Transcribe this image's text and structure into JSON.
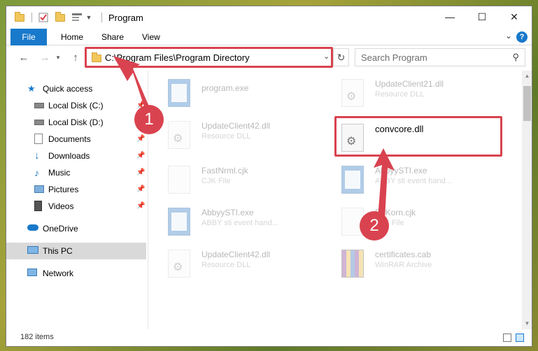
{
  "window": {
    "title": "Program",
    "controls": {
      "minimize": "—",
      "maximize": "☐",
      "close": "✕"
    }
  },
  "ribbon": {
    "tabs": [
      "File",
      "Home",
      "Share",
      "View"
    ],
    "help": "?"
  },
  "address": {
    "path": "C:\\Program Files\\Program Directory",
    "search_placeholder": "Search Program"
  },
  "sidebar": {
    "items": [
      {
        "label": "Quick access",
        "icon": "star-icon"
      },
      {
        "label": "Local Disk (C:)",
        "icon": "drive-icon"
      },
      {
        "label": "Local Disk (D:)",
        "icon": "drive-icon"
      },
      {
        "label": "Documents",
        "icon": "documents-icon"
      },
      {
        "label": "Downloads",
        "icon": "download-icon"
      },
      {
        "label": "Music",
        "icon": "music-icon"
      },
      {
        "label": "Pictures",
        "icon": "pictures-icon"
      },
      {
        "label": "Videos",
        "icon": "videos-icon"
      },
      {
        "label": "OneDrive",
        "icon": "cloud-icon"
      },
      {
        "label": "This PC",
        "icon": "computer-icon"
      },
      {
        "label": "Network",
        "icon": "network-icon"
      }
    ]
  },
  "files": [
    {
      "name": "program.exe",
      "type": ""
    },
    {
      "name": "UpdateClient21.dll",
      "type": "Resource DLL"
    },
    {
      "name": "UpdateClient42.dll",
      "type": "Resource DLL"
    },
    {
      "name": "convcore.dll",
      "type": ""
    },
    {
      "name": "FastNrml.cjk",
      "type": "CJK File"
    },
    {
      "name": "AbbyySTI.exe",
      "type": "ABBY sti event hand..."
    },
    {
      "name": "AbbyySTI.exe",
      "type": "ABBY sti event hand..."
    },
    {
      "name": "EdKorn.cjk",
      "type": "CJK File"
    },
    {
      "name": "UpdateClient42.dll",
      "type": "Resource DLL"
    },
    {
      "name": "certificates.cab",
      "type": "WinRAR Archive"
    }
  ],
  "status": {
    "item_count": "182 items"
  },
  "annotations": {
    "step1": "1",
    "step2": "2"
  },
  "colors": {
    "accent": "#1979ca",
    "highlight": "#d9434f"
  }
}
